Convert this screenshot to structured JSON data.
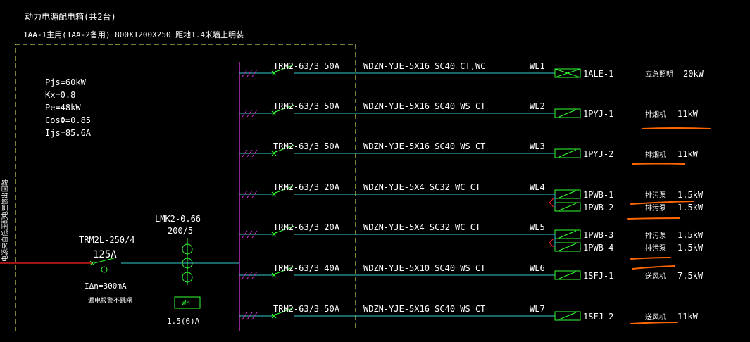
{
  "panel": {
    "title": "动力电源配电箱(共2台)",
    "spec": "1AA-1主用(1AA-2备用) 800X1200X250  距地1.4米墙上明装"
  },
  "load_params": [
    "Pjs=60kW",
    "Kx=0.8",
    "Pe=48kW",
    "CosΦ=0.85",
    "Ijs=85.6A"
  ],
  "incoming": {
    "side_text": "电源来自低压配电室馈出回路",
    "breaker_model": "TRM2L-250/4",
    "breaker_rating": "125A",
    "residual": "IΔn=300mA",
    "residual_note": "漏电报警不跳闸"
  },
  "meter": {
    "ct_model": "LMK2-0.66",
    "ct_ratio": "200/5",
    "label": "Wh",
    "rating": "1.5(6)A"
  },
  "circuits": [
    {
      "breaker": "TRM2-63/3 50A",
      "cable": "WDZN-YJE-5X16 SC40 CT,WC",
      "wl": "WL1",
      "loads": [
        {
          "id": "1ALE-1",
          "name": "应急照明",
          "power": "20kW"
        }
      ]
    },
    {
      "breaker": "TRM2-63/3 50A",
      "cable": "WDZN-YJE-5X16 SC40 WS CT",
      "wl": "WL2",
      "loads": [
        {
          "id": "1PYJ-1",
          "name": "排烟机",
          "power": "11kW"
        }
      ]
    },
    {
      "breaker": "TRM2-63/3 50A",
      "cable": "WDZN-YJE-5X16 SC40 WS CT",
      "wl": "WL3",
      "loads": [
        {
          "id": "1PYJ-2",
          "name": "排烟机",
          "power": "11kW"
        }
      ]
    },
    {
      "breaker": "TRM2-63/3 20A",
      "cable": "WDZN-YJE-5X4 SC32 WC CT",
      "wl": "WL4",
      "loads": [
        {
          "id": "1PWB-1",
          "name": "排污泵",
          "power": "1.5kW"
        },
        {
          "id": "1PWB-2",
          "name": "排污泵",
          "power": "1.5kW"
        }
      ]
    },
    {
      "breaker": "TRM2-63/3 20A",
      "cable": "WDZN-YJE-5X4 SC32 WC CT",
      "wl": "WL5",
      "loads": [
        {
          "id": "1PWB-3",
          "name": "排污泵",
          "power": "1.5kW"
        },
        {
          "id": "1PWB-4",
          "name": "排污泵",
          "power": "1.5kW"
        }
      ]
    },
    {
      "breaker": "TRM2-63/3 40A",
      "cable": "WDZN-YJE-5X10 SC40 WS CT",
      "wl": "WL6",
      "loads": [
        {
          "id": "1SFJ-1",
          "name": "送风机",
          "power": "7.5kW"
        }
      ]
    },
    {
      "breaker": "TRM2-63/3 50A",
      "cable": "WDZN-YJE-5X16 SC40 WS CT",
      "wl": "WL7",
      "loads": [
        {
          "id": "1SFJ-2",
          "name": "送风机",
          "power": "11kW"
        }
      ]
    }
  ],
  "colors": {
    "background": "#000000",
    "text": "#ffffff",
    "bus": "#cc33cc",
    "wire": "#33cccc",
    "device": "#33ff33",
    "frame": "#ffff66",
    "markup": "#ff6600",
    "incoming": "#ff2020"
  }
}
